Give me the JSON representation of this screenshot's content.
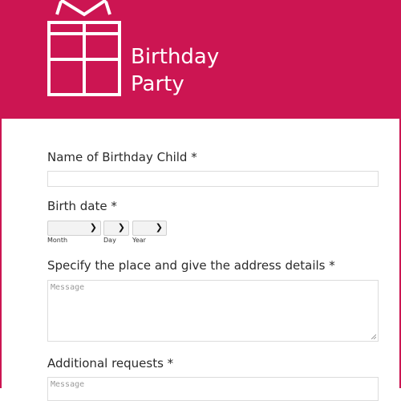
{
  "header": {
    "title_line1": "Birthday",
    "title_line2": "Party",
    "color": "#cc1552",
    "icon": "gift-icon"
  },
  "form": {
    "child_name": {
      "label": "Name of Birthday Child *",
      "value": ""
    },
    "birth_date": {
      "label": "Birth date *",
      "month_label": "Month",
      "day_label": "Day",
      "year_label": "Year"
    },
    "place": {
      "label": "Specify the place and give the address details *",
      "placeholder": "Message"
    },
    "requests": {
      "label": "Additional requests *",
      "placeholder": "Message"
    }
  }
}
